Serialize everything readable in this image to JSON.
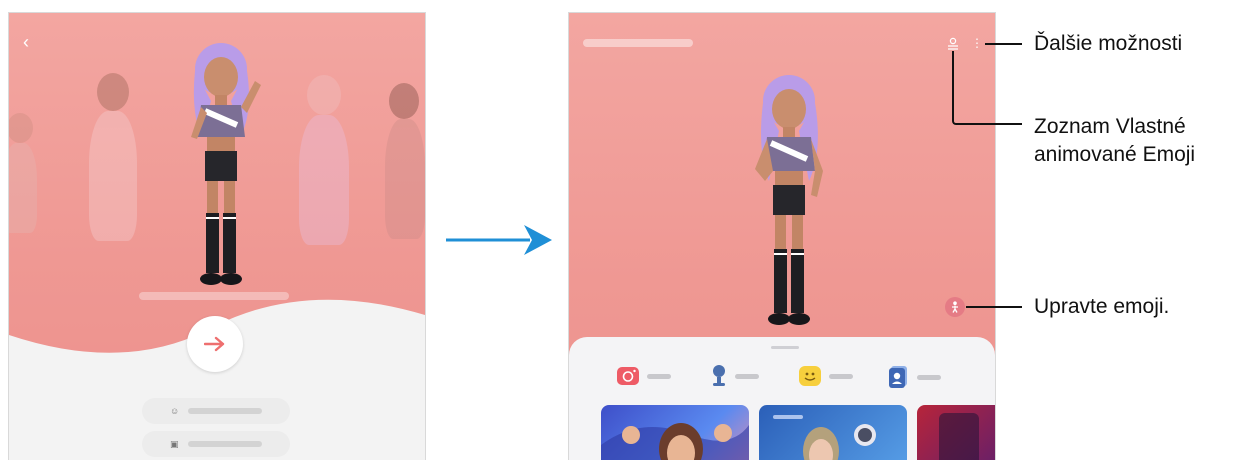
{
  "callouts": {
    "more_options": "Ďalšie možnosti",
    "emoji_list_line1": "Zoznam Vlastné",
    "emoji_list_line2": "animované Emoji",
    "edit_emoji": "Upravte emoji."
  },
  "colors": {
    "screen_bg": "#ef9893",
    "panel_bg": "#f4f4f6",
    "arrow": "#1f8fd6",
    "edit_button": "#e57b85"
  },
  "icons": {
    "back": "chevron-left-icon",
    "next": "arrow-right-icon",
    "create_from_selfie": "face-icon",
    "create_from_image": "image-icon",
    "emoji_list": "person-list-icon",
    "more_options": "more-vertical-icon",
    "edit_emoji": "person-icon",
    "camera": "camera-icon",
    "stickers": "sticker-icon",
    "profile": "profile-icon",
    "mask": "mask-icon"
  }
}
